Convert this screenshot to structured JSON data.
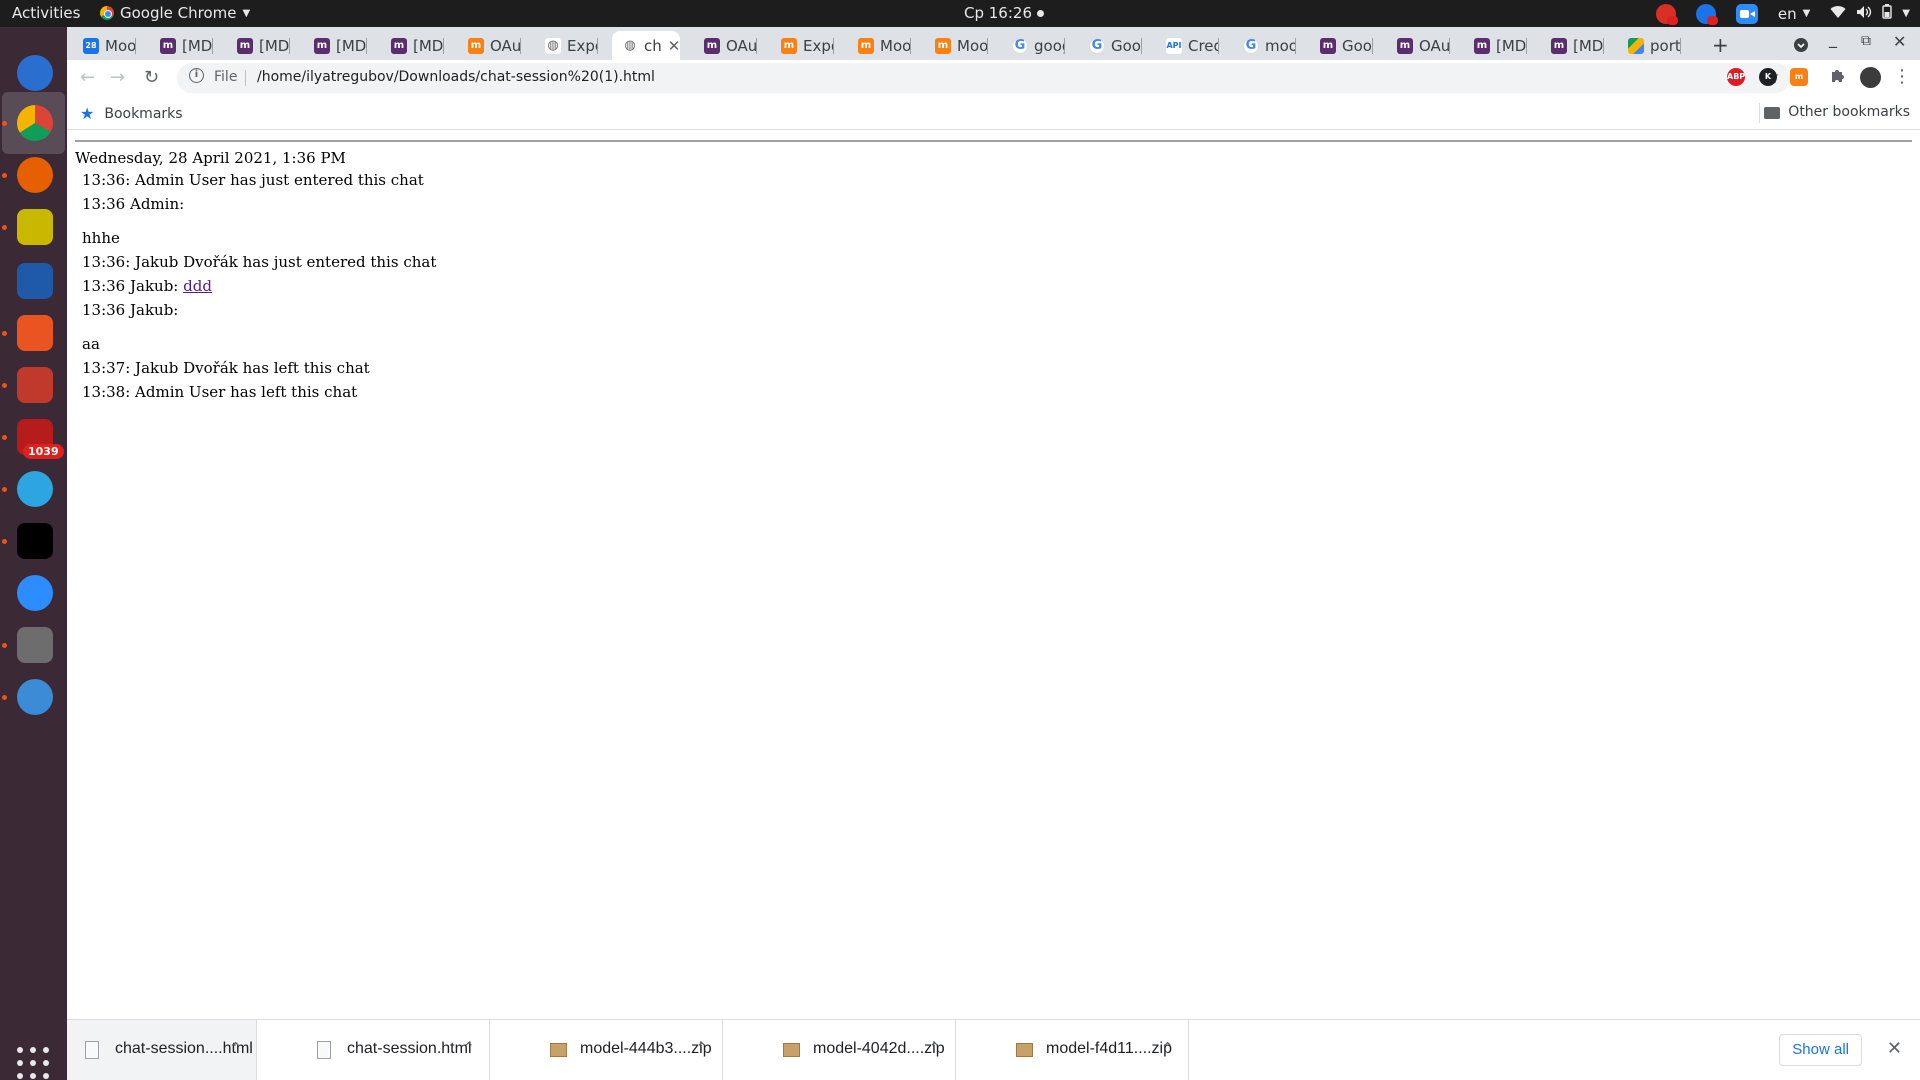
{
  "system_bar": {
    "activities": "Activities",
    "app_name": "Google Chrome",
    "clock": "Ср 16:26",
    "language": "en"
  },
  "dock": {
    "items": [
      {
        "name": "thunderbird-icon",
        "color": "#2a6fcf"
      },
      {
        "name": "chrome-icon",
        "color": "#db4437"
      },
      {
        "name": "firefox-icon",
        "color": "#e66000"
      },
      {
        "name": "rhythmbox-icon",
        "color": "#c9b800"
      },
      {
        "name": "libreoffice-writer-icon",
        "color": "#1e5aa8"
      },
      {
        "name": "software-center-icon",
        "color": "#e95420"
      },
      {
        "name": "settings-tool-icon",
        "color": "#c0392b"
      },
      {
        "name": "terminal-tiles-icon",
        "color": "#b71c1c"
      },
      {
        "name": "telegram-icon",
        "color": "#2ca5e0"
      },
      {
        "name": "phpstorm-icon",
        "color": "#000000"
      },
      {
        "name": "zoom-icon",
        "color": "#2d8cff"
      },
      {
        "name": "file-manager-icon",
        "color": "#6d6d6d"
      },
      {
        "name": "blue-swirl-app-icon",
        "color": "#3b8bd6"
      }
    ],
    "telegram_badge": "1039"
  },
  "tabs": [
    {
      "label": "Mooc",
      "favicon": "cal"
    },
    {
      "label": "[MDL",
      "favicon": "mdl"
    },
    {
      "label": "[MDL",
      "favicon": "mdl"
    },
    {
      "label": "[MDL",
      "favicon": "mdl"
    },
    {
      "label": "[MDL",
      "favicon": "mdl"
    },
    {
      "label": "OAut",
      "favicon": "moodle"
    },
    {
      "label": "Expo",
      "favicon": "globe"
    },
    {
      "label": "ch",
      "favicon": "globe",
      "active": true
    },
    {
      "label": "OAut",
      "favicon": "mdl"
    },
    {
      "label": "Expo",
      "favicon": "moodle"
    },
    {
      "label": "Mooc",
      "favicon": "moodle"
    },
    {
      "label": "Mooc",
      "favicon": "moodle"
    },
    {
      "label": "goog",
      "favicon": "google"
    },
    {
      "label": "Goog",
      "favicon": "google"
    },
    {
      "label": "Crede",
      "favicon": "api"
    },
    {
      "label": "mooc",
      "favicon": "google"
    },
    {
      "label": "Goog",
      "favicon": "mdl"
    },
    {
      "label": "OAut",
      "favicon": "mdl"
    },
    {
      "label": "[MDL",
      "favicon": "mdl"
    },
    {
      "label": "[MDL",
      "favicon": "mdl"
    },
    {
      "label": "portf",
      "favicon": "drive"
    }
  ],
  "toolbar": {
    "scheme": "File",
    "url": "/home/ilyatregubov/Downloads/chat-session%20(1).html"
  },
  "bookmarks": {
    "main": "Bookmarks",
    "other": "Other bookmarks"
  },
  "page": {
    "session_date": "Wednesday, 28 April 2021, 1:36 PM",
    "messages": [
      {
        "text": "13:36: Admin User has just entered this chat"
      },
      {
        "text": "13:36 Admin:"
      },
      {
        "gap": true
      },
      {
        "text": "hhhe"
      },
      {
        "text": "13:36: Jakub Dvořák has just entered this chat"
      },
      {
        "text": "13:36 Jakub: ",
        "link": "ddd"
      },
      {
        "text": "13:36 Jakub:"
      },
      {
        "gap": true
      },
      {
        "text": "aa"
      },
      {
        "text": "13:37: Jakub Dvořák has left this chat"
      },
      {
        "text": "13:38: Admin User has left this chat"
      }
    ]
  },
  "downloads": {
    "items": [
      {
        "name": "chat-session....html",
        "type": "html"
      },
      {
        "name": "chat-session.html",
        "type": "html"
      },
      {
        "name": "model-444b3....zip",
        "type": "zip"
      },
      {
        "name": "model-4042d....zip",
        "type": "zip"
      },
      {
        "name": "model-f4d11....zip",
        "type": "zip"
      }
    ],
    "show_all": "Show all"
  }
}
